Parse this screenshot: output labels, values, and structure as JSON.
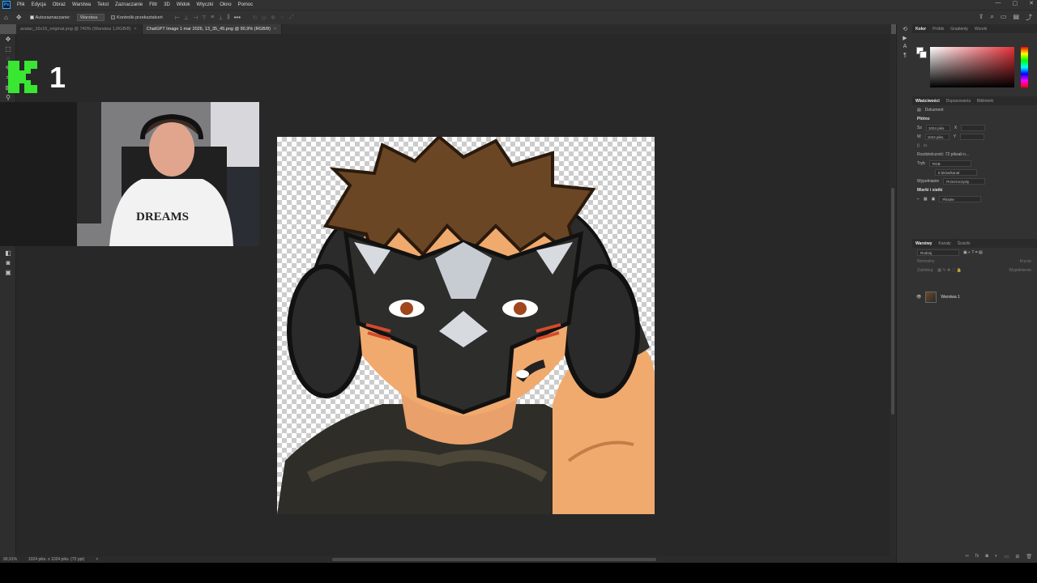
{
  "app": {
    "logo": "Ps",
    "menu": [
      "Plik",
      "Edycja",
      "Obraz",
      "Warstwa",
      "Tekst",
      "Zaznaczanie",
      "Filtr",
      "3D",
      "Widok",
      "Wtyczki",
      "Okno",
      "Pomoc"
    ],
    "window_controls": [
      "—",
      "▢",
      "✕"
    ]
  },
  "options_bar": {
    "auto_select_label": "Autozaznaczanie:",
    "auto_select_mode": "Warstwa",
    "transform_controls_label": "Kontrolki przekształceń",
    "more": "•••"
  },
  "tabs": [
    {
      "title": "avatar_16x16_original.png @ 740% (Warstwa 1,RGB/8)",
      "close": "×"
    },
    {
      "title": "ChatGPT Image 1 mar 2026, 13_35_45.png @ 90,9% (RGB/8)",
      "close": "×"
    }
  ],
  "status_bar": {
    "zoom": "90,91%",
    "doc_info": "1024 piks. x 1024 piks. (72 ppi)",
    "arrow": ">"
  },
  "color_panel": {
    "tabs": [
      "Kolor",
      "Próbki",
      "Gradienty",
      "Wzorki"
    ],
    "active": "Kolor",
    "hue_color": "#e6323a"
  },
  "properties_panel": {
    "tabs": [
      "Właściwości",
      "Dopasowania",
      "Biblioteki"
    ],
    "active": "Właściwości",
    "document_label": "Dokument",
    "canvas_header": "Płótno",
    "width_label": "Sz",
    "width_value": "1024 piks.",
    "height_label": "W",
    "height_value": "1024 piks.",
    "x_label": "X",
    "y_label": "Y",
    "resolution": "Rozdzielczość: 72 piksali n...",
    "mode_label": "Tryb",
    "mode_value": "RGB",
    "depth_value": "8 bitów/kanał",
    "fill_label": "Wypełnianie",
    "fill_value": "Przezroczysty",
    "rulers_header": "Miarki i siatki",
    "units_value": "Piksele"
  },
  "layers_panel": {
    "tabs": [
      "Warstwy",
      "Kanały",
      "Ścieżki"
    ],
    "active": "Warstwy",
    "search_kind": "Rodzaj",
    "blend_mode": "Normalny",
    "opacity_label": "Krycie:",
    "lock_label": "Zablokuj:",
    "fill_label": "Wypełnienie:",
    "layers": [
      {
        "name": "Warstwa 1",
        "visible": true
      }
    ]
  },
  "overlay": {
    "logo_number": "1",
    "logo_color": "#39e632",
    "shirt_text": "DREAMS"
  }
}
